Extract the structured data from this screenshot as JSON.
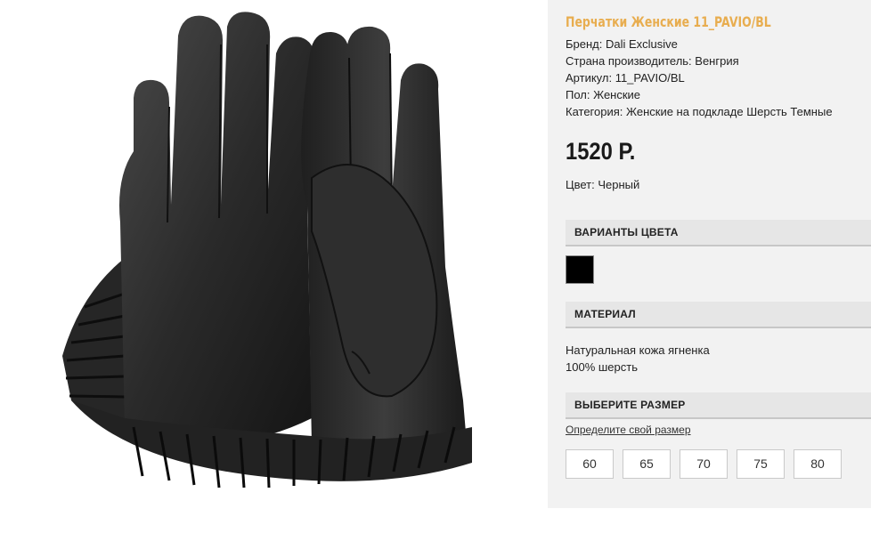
{
  "product": {
    "title": "Перчатки Женские 11_PAVIO/BL",
    "image_alt": "leather-gloves-photo"
  },
  "specs": [
    "Бренд: Dali Exclusive",
    "Страна производитель: Венгрия",
    "Артикул: 11_PAVIO/BL",
    "Пол: Женские",
    "Категория: Женские на подкладе Шерсть Темные"
  ],
  "price": "1520 Р.",
  "color_line": "Цвет: Черный",
  "sections": {
    "color_variants": "ВАРИАНТЫ ЦВЕТА",
    "material": "МАТЕРИАЛ",
    "size": "ВЫБЕРИТЕ РАЗМЕР"
  },
  "swatches": [
    {
      "color": "#000000",
      "name": "black"
    }
  ],
  "material_lines": [
    "Натуральная кожа ягненка",
    "100% шерсть"
  ],
  "size_link": "Определите свой размер",
  "sizes": [
    "60",
    "65",
    "70",
    "75",
    "80"
  ]
}
